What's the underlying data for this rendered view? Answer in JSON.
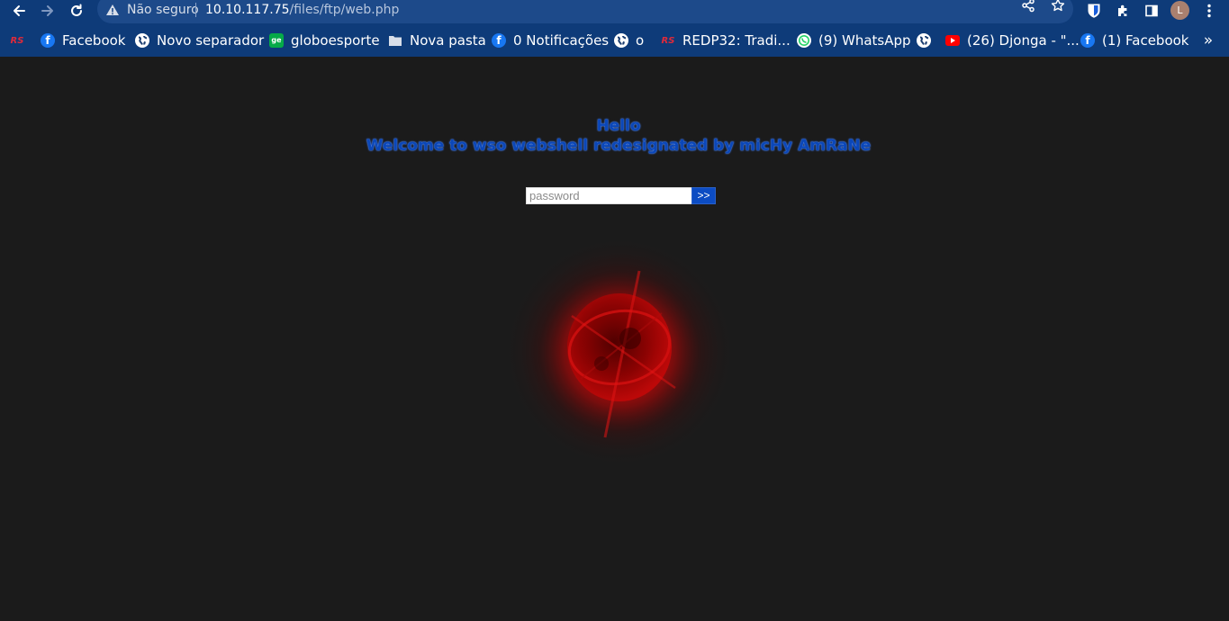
{
  "browser": {
    "security_label": "Não seguro",
    "url_host": "10.10.117.75",
    "url_path": "/files/ftp/web.php",
    "profile_initial": "L"
  },
  "bookmarks": [
    {
      "label": "",
      "icon": "redsauce-icon"
    },
    {
      "label": "Facebook",
      "icon": "facebook-icon"
    },
    {
      "label": "Novo separador",
      "icon": "globe-icon"
    },
    {
      "label": "globoesporte",
      "icon": "ge-icon"
    },
    {
      "label": "Nova pasta",
      "icon": "folder-icon"
    },
    {
      "label": "0 Notificações",
      "icon": "facebook-icon"
    },
    {
      "label": "o",
      "icon": "globe-icon"
    },
    {
      "label": "REDP32: Tradi...",
      "icon": "redsauce-icon"
    },
    {
      "label": "(9) WhatsApp",
      "icon": "whatsapp-icon"
    },
    {
      "label": "",
      "icon": "globe-icon"
    },
    {
      "label": "(26) Djonga - \"...",
      "icon": "youtube-icon"
    },
    {
      "label": "(1) Facebook",
      "icon": "facebook-icon"
    }
  ],
  "bookmarks_more": "»",
  "page": {
    "greeting": "Hello",
    "welcome": "Welcome to wso webshell redesignated by micHy AmRaNe",
    "password_placeholder": "password",
    "submit_label": ">>"
  },
  "colors": {
    "browser_bar": "#0e3b79",
    "page_background": "#1b1b1b",
    "heading_blue": "#0b47b8",
    "button_blue": "#0c4cc3",
    "orb_red": "#c40a0a"
  }
}
